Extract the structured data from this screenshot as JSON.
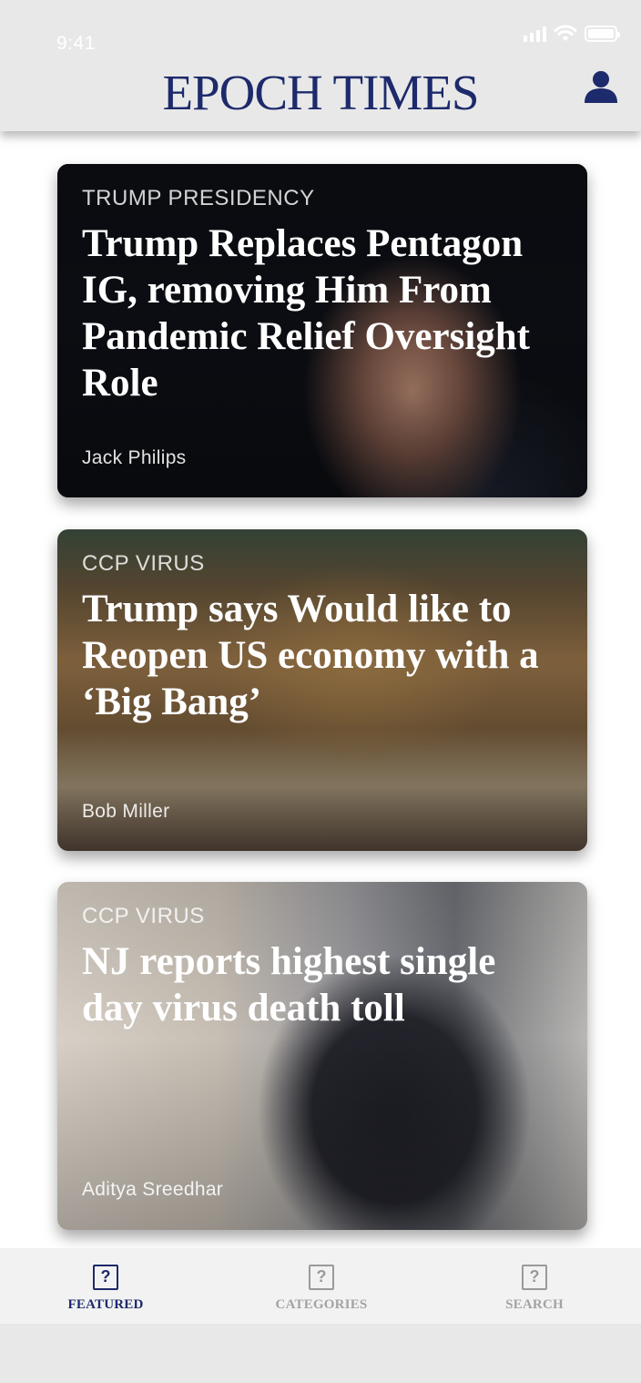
{
  "status_bar": {
    "time": "9:41"
  },
  "header": {
    "logo_text": "EPOCH TIMES",
    "profile_icon": "person-icon",
    "brand_color": "#1d2a6b"
  },
  "articles": [
    {
      "category": "TRUMP PRESIDENCY",
      "title": "Trump Replaces Pentagon IG, removing Him From Pandemic Relief Oversight Role",
      "author": "Jack Philips"
    },
    {
      "category": "CCP VIRUS",
      "title": "Trump says Would like to Reopen US economy with a ‘Big Bang’",
      "author": "Bob Miller"
    },
    {
      "category": "CCP VIRUS",
      "title": "NJ reports highest single day virus death toll",
      "author": "Aditya Sreedhar"
    }
  ],
  "tabbar": {
    "active": "featured",
    "tabs": [
      {
        "label": "FEATURED",
        "icon": "placeholder-icon"
      },
      {
        "label": "CATEGORIES",
        "icon": "placeholder-icon"
      },
      {
        "label": "SEARCH",
        "icon": "placeholder-icon"
      }
    ],
    "icon_glyph": "?",
    "active_color": "#1d2a6b",
    "inactive_color": "#a3a3a3"
  }
}
